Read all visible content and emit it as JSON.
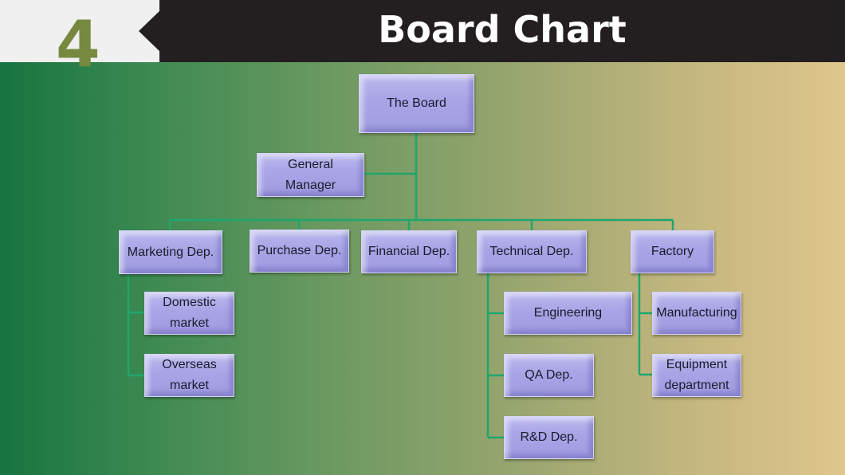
{
  "header": {
    "section_number": "4",
    "title": "Board Chart"
  },
  "colors": {
    "header_bar": "#231f20",
    "number": "#76893e",
    "connector": "#1fa66e",
    "node_fill": "#a9a5e6"
  },
  "org_chart": {
    "root": "The Board",
    "assistant": "General Manager",
    "departments": [
      {
        "name": "Marketing Dep.",
        "children": [
          "Domestic market",
          "Overseas market"
        ]
      },
      {
        "name": "Purchase Dep.",
        "children": []
      },
      {
        "name": "Financial Dep.",
        "children": []
      },
      {
        "name": "Technical Dep.",
        "children": [
          "Engineering",
          "QA Dep.",
          "R&D Dep."
        ]
      },
      {
        "name": "Factory",
        "children": [
          "Manufacturing",
          "Equipment department"
        ]
      }
    ]
  },
  "nodes": {
    "board": "The Board",
    "gm_line1": "General",
    "gm_line2": "Manager",
    "marketing": "Marketing Dep.",
    "purchase": "Purchase Dep.",
    "financial": "Financial Dep.",
    "technical": "Technical Dep.",
    "factory": "Factory",
    "domestic_line1": "Domestic",
    "domestic_line2": "market",
    "overseas_line1": "Overseas",
    "overseas_line2": "market",
    "engineering": "Engineering",
    "qa": "QA Dep.",
    "rd": "R&D Dep.",
    "manufacturing": "Manufacturing",
    "equipment_line1": "Equipment",
    "equipment_line2": "department"
  }
}
